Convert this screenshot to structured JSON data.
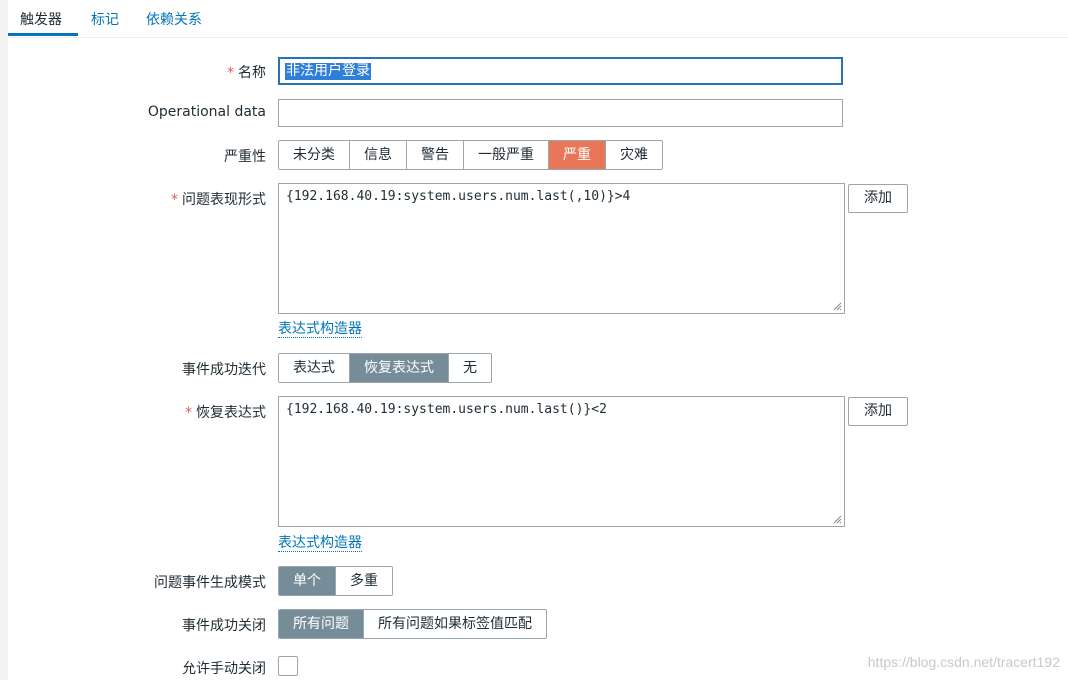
{
  "tabs": [
    {
      "label": "触发器",
      "active": true
    },
    {
      "label": "标记"
    },
    {
      "label": "依赖关系"
    }
  ],
  "form": {
    "name": {
      "label": "名称",
      "value": "非法用户登录"
    },
    "operational_data": {
      "label": "Operational data",
      "value": ""
    },
    "severity": {
      "label": "严重性",
      "options": [
        "未分类",
        "信息",
        "警告",
        "一般严重",
        "严重",
        "灾难"
      ],
      "selected": "严重"
    },
    "problem_expression": {
      "label": "问题表现形式",
      "value": "{192.168.40.19:system.users.num.last(,10)}>4",
      "add_label": "添加",
      "builder_link": "表达式构造器"
    },
    "ok_event_generation": {
      "label": "事件成功迭代",
      "options": [
        "表达式",
        "恢复表达式",
        "无"
      ],
      "selected": "恢复表达式"
    },
    "recovery_expression": {
      "label": "恢复表达式",
      "value": "{192.168.40.19:system.users.num.last()}<2",
      "add_label": "添加",
      "builder_link": "表达式构造器"
    },
    "problem_event_mode": {
      "label": "问题事件生成模式",
      "options": [
        "单个",
        "多重"
      ],
      "selected": "单个"
    },
    "ok_event_closes": {
      "label": "事件成功关闭",
      "options": [
        "所有问题",
        "所有问题如果标签值匹配"
      ],
      "selected": "所有问题"
    },
    "allow_manual_close": {
      "label": "允许手动关闭",
      "checked": false
    }
  },
  "required_marker": "*",
  "watermark": "https://blog.csdn.net/tracert192",
  "colors": {
    "accent": "#0275b8",
    "severity_selected": "#e97659",
    "toggle_selected": "#768d99"
  }
}
